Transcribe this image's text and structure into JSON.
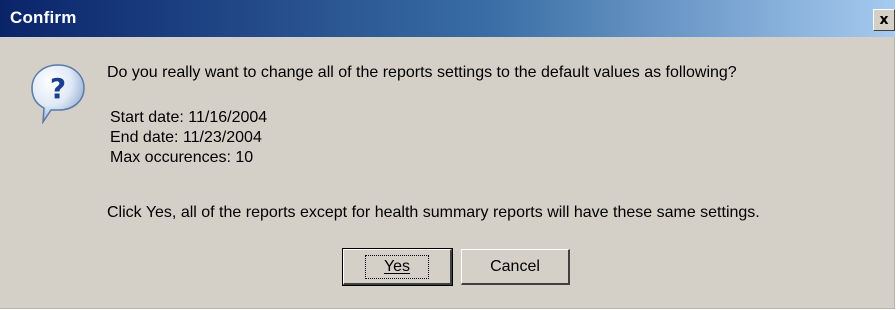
{
  "window": {
    "title": "Confirm",
    "close_glyph": "x"
  },
  "icon": {
    "name": "question-icon",
    "glyph": "?"
  },
  "message": "Do you really want to change all of the reports settings to the default values as following?",
  "details": [
    "Start date: 11/16/2004",
    "End date: 11/23/2004",
    "Max occurences: 10"
  ],
  "note": "Click Yes, all of the reports except for health summary reports will have these same settings.",
  "buttons": {
    "yes": "Yes",
    "cancel": "Cancel"
  },
  "colors": {
    "titlebar_start": "#0a246a",
    "titlebar_end": "#a6caf0",
    "dialog_background": "#d4d0c8"
  }
}
